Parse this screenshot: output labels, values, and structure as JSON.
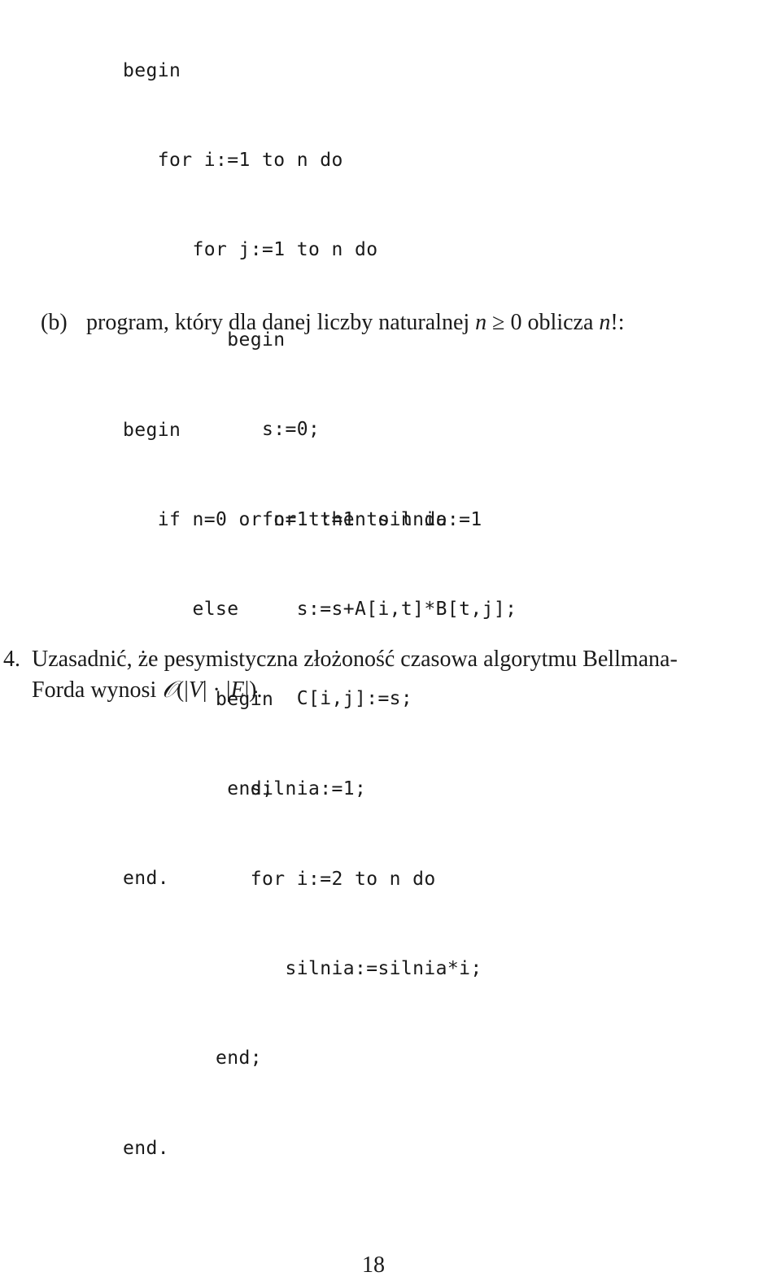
{
  "code_block_a": {
    "lines": [
      "begin",
      "   for i:=1 to n do",
      "      for j:=1 to n do",
      "         begin",
      "            s:=0;",
      "            for t:=1 to n do",
      "               s:=s+A[i,t]*B[t,j];",
      "               C[i,j]:=s;",
      "         end;",
      "end."
    ]
  },
  "item_b": {
    "label": "(b)",
    "text_before": "program, który dla danej liczby naturalnej ",
    "math_var": "n",
    "math_rel": " ≥ 0 ",
    "text_middle": "oblicza ",
    "math_var2": "n",
    "text_after": "!:"
  },
  "code_block_b": {
    "lines": [
      "begin",
      "   if n=0 or n=1 then silnia:=1",
      "      else",
      "        begin",
      "           silnia:=1;",
      "           for i:=2 to n do",
      "              silnia:=silnia*i;",
      "        end;",
      "end."
    ]
  },
  "task_4": {
    "number": "4.",
    "line1": "Uzasadnić, że pesymistyczna złożoność czasowa algorytmu Bellmana-",
    "line2_text": "Forda wynosi ",
    "line2_bigO": "𝒪",
    "line2_open": "(|",
    "line2_V": "V",
    "line2_mid": "| · |",
    "line2_E": "E",
    "line2_close": "|)."
  },
  "page_number": "18"
}
